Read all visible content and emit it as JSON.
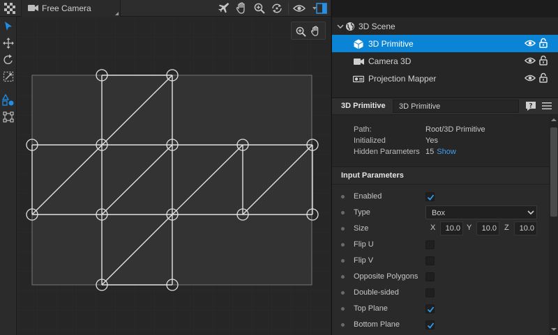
{
  "toolbar": {
    "camera_label": "Free Camera",
    "icons": [
      "checker-icon",
      "camera-icon",
      "airplane-icon",
      "hand-icon",
      "zoom-icon",
      "reset-view-icon",
      "eye-icon",
      "panel-toggle-icon"
    ]
  },
  "left_tools": [
    "select-arrow-icon",
    "move-icon",
    "rotate-icon",
    "scale-icon",
    "vertex-edit-icon",
    "crop-icon"
  ],
  "viewport": {
    "zoom_pan_icons": [
      "zoom-icon",
      "hand-icon"
    ],
    "accent_color": "#0b84d6"
  },
  "scene_tree": {
    "root": {
      "label": "3D Scene",
      "icon": "globe-icon"
    },
    "items": [
      {
        "label": "3D Primitive",
        "icon": "cube-icon",
        "selected": true
      },
      {
        "label": "Camera 3D",
        "icon": "video-camera-icon",
        "selected": false
      },
      {
        "label": "Projection Mapper",
        "icon": "projector-icon",
        "selected": false
      }
    ]
  },
  "inspector": {
    "title": "3D Primitive",
    "name_value": "3D Primitive",
    "info": {
      "path_label": "Path:",
      "path_value": "Root/3D Primitive",
      "initialized_label": "Initialized",
      "initialized_value": "Yes",
      "hidden_label": "Hidden Parameters",
      "hidden_count": "15",
      "show_link": "Show"
    },
    "section_title": "Input Parameters",
    "params": {
      "enabled": {
        "label": "Enabled",
        "checked": true
      },
      "type": {
        "label": "Type",
        "value": "Box"
      },
      "size": {
        "label": "Size",
        "x_label": "X",
        "x": "10.0",
        "y_label": "Y",
        "y": "10.0",
        "z_label": "Z",
        "z": "10.0"
      },
      "flip_u": {
        "label": "Flip U",
        "checked": false
      },
      "flip_v": {
        "label": "Flip V",
        "checked": false
      },
      "opposite_polygons": {
        "label": "Opposite Polygons",
        "checked": false
      },
      "double_sided": {
        "label": "Double-sided",
        "checked": false
      },
      "top_plane": {
        "label": "Top Plane",
        "checked": true
      },
      "bottom_plane": {
        "label": "Bottom Plane",
        "checked": true
      }
    }
  }
}
